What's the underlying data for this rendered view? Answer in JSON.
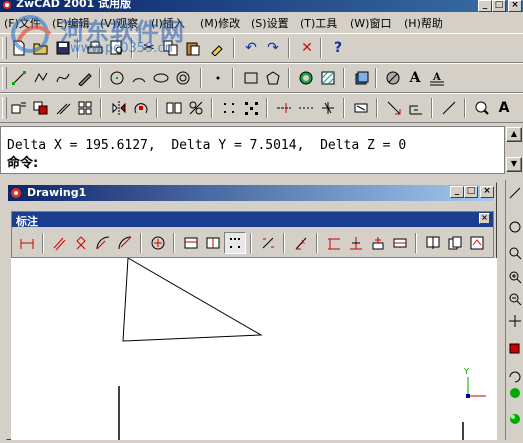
{
  "window": {
    "title": "ZwCAD 2001 试用版"
  },
  "menu": [
    {
      "key": "menu-file",
      "label": "(F)文件"
    },
    {
      "key": "menu-edit",
      "label": "(E)编辑"
    },
    {
      "key": "menu-view",
      "label": "(V)观察"
    },
    {
      "key": "menu-insert",
      "label": "(I)插入"
    },
    {
      "key": "menu-modify",
      "label": "(M)修改"
    },
    {
      "key": "menu-settings",
      "label": "(S)设置"
    },
    {
      "key": "menu-tools",
      "label": "(T)工具"
    },
    {
      "key": "menu-window",
      "label": "(W)窗口"
    },
    {
      "key": "menu-help",
      "label": "(H)帮助"
    }
  ],
  "watermark": {
    "text": "河东软件网",
    "url": "www.pc0359.cn"
  },
  "command": {
    "line1": "Delta X = 195.6127,  Delta Y = 7.5014,  Delta Z = 0",
    "line2": "命令:"
  },
  "drawing": {
    "title": "Drawing1"
  },
  "dim_toolbar": {
    "title": "标注"
  },
  "ucs": {
    "y_label": "Y"
  },
  "icons": {
    "standard": [
      "new-icon",
      "open-icon",
      "save-icon",
      "print-icon",
      "preview-icon",
      "cut-icon",
      "copy-icon",
      "paste-icon",
      "match-prop-icon",
      "undo-icon",
      "redo-icon",
      "delete-icon",
      "help-icon"
    ],
    "draw": [
      "line-icon",
      "polyline-icon",
      "spline-icon",
      "sketch-icon",
      "circle-icon",
      "arc-icon",
      "ellipse-icon",
      "point-icon",
      "rectangle-icon",
      "polygon-icon",
      "donut-icon",
      "hatch-icon",
      "region-icon",
      "block-icon",
      "text-icon",
      "mtext-icon"
    ],
    "modify": [
      "move-icon",
      "copy-obj-icon",
      "offset-icon",
      "array-icon",
      "mirror-icon",
      "rotate-icon",
      "scale-icon",
      "stretch-icon",
      "grid-icon",
      "snap-icon",
      "trim-icon",
      "extend-icon",
      "break-icon",
      "chamfer-icon",
      "fillet-icon",
      "explode-icon",
      "zoom-icon",
      "text-style-icon"
    ],
    "dim": [
      "dim-linear-icon",
      "dim-aligned-icon",
      "dim-ordinate-icon",
      "dim-radius-icon",
      "dim-diameter-icon",
      "dim-center-icon",
      "dim-baseline-icon",
      "dim-continue-icon",
      "dim-leader-icon",
      "dim-tolerance-icon",
      "dim-angular-icon",
      "dim-edit-icon",
      "dim-update-icon",
      "dim-override-icon",
      "dim-style-icon",
      "dim-text-icon",
      "dim-oblique-icon",
      "dim-home-icon"
    ]
  }
}
